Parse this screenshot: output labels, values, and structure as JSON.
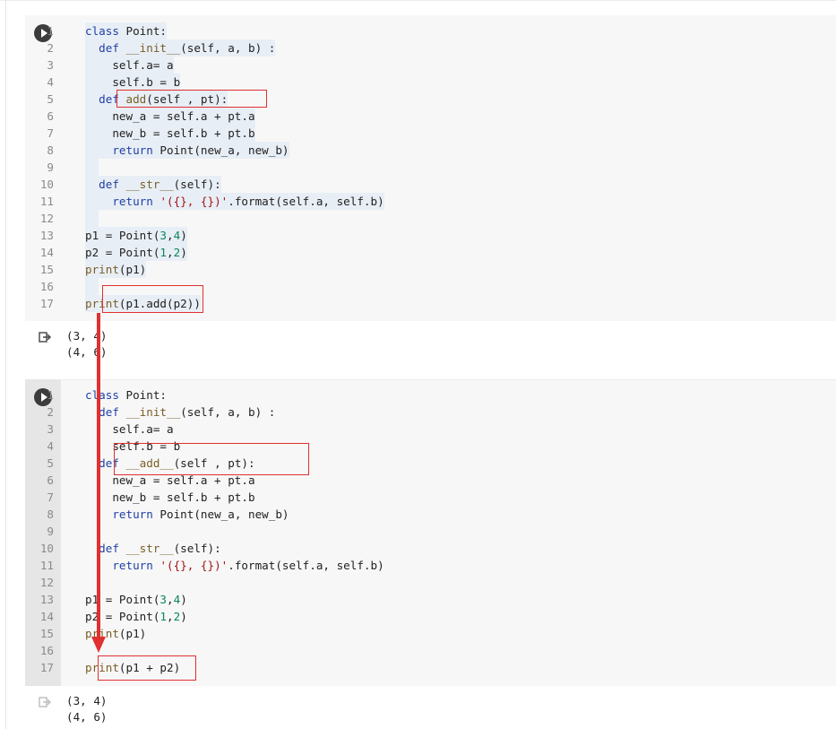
{
  "cells": [
    {
      "id": "cell-1",
      "run_icon": "play-circle-icon",
      "lines": [
        {
          "n": "1",
          "tokens": [
            [
              "kw",
              "class"
            ],
            [
              "",
              " Point:"
            ]
          ]
        },
        {
          "n": "2",
          "tokens": [
            [
              "",
              "  "
            ],
            [
              "kw",
              "def"
            ],
            [
              "",
              " "
            ],
            [
              "fn",
              "__init__"
            ],
            [
              "",
              "(self, a, b) :"
            ]
          ]
        },
        {
          "n": "3",
          "tokens": [
            [
              "",
              "    self.a= a"
            ]
          ]
        },
        {
          "n": "4",
          "tokens": [
            [
              "",
              "    self.b = b"
            ]
          ]
        },
        {
          "n": "5",
          "tokens": [
            [
              "",
              "  "
            ],
            [
              "kw",
              "def"
            ],
            [
              "",
              " "
            ],
            [
              "fn",
              "add"
            ],
            [
              "",
              "(self , pt):"
            ]
          ]
        },
        {
          "n": "6",
          "tokens": [
            [
              "",
              "    new_a = self.a + pt.a"
            ]
          ]
        },
        {
          "n": "7",
          "tokens": [
            [
              "",
              "    new_b = self.b + pt.b"
            ]
          ]
        },
        {
          "n": "8",
          "tokens": [
            [
              "",
              "    "
            ],
            [
              "kw",
              "return"
            ],
            [
              "",
              " Point(new_a, new_b)"
            ]
          ]
        },
        {
          "n": "9",
          "tokens": [
            [
              "",
              "  "
            ]
          ]
        },
        {
          "n": "10",
          "tokens": [
            [
              "",
              "  "
            ],
            [
              "kw",
              "def"
            ],
            [
              "",
              " "
            ],
            [
              "fn",
              "__str__"
            ],
            [
              "",
              "(self):"
            ]
          ]
        },
        {
          "n": "11",
          "tokens": [
            [
              "",
              "    "
            ],
            [
              "kw",
              "return"
            ],
            [
              "",
              " "
            ],
            [
              "st",
              "'({}, {})'"
            ],
            [
              "",
              ".format(self.a, self.b)"
            ]
          ]
        },
        {
          "n": "12",
          "tokens": [
            [
              "",
              "  "
            ]
          ]
        },
        {
          "n": "13",
          "tokens": [
            [
              "",
              "p1 = Point("
            ],
            [
              "nm",
              "3"
            ],
            [
              "",
              ","
            ],
            [
              "nm",
              "4"
            ],
            [
              "",
              ")"
            ]
          ]
        },
        {
          "n": "14",
          "tokens": [
            [
              "",
              "p2 = Point("
            ],
            [
              "nm",
              "1"
            ],
            [
              "",
              ","
            ],
            [
              "nm",
              "2"
            ],
            [
              "",
              ")"
            ]
          ]
        },
        {
          "n": "15",
          "tokens": [
            [
              "fn",
              "print"
            ],
            [
              "",
              "(p1)"
            ]
          ]
        },
        {
          "n": "16",
          "tokens": [
            [
              "",
              "  "
            ]
          ]
        },
        {
          "n": "17",
          "tokens": [
            [
              "fn",
              "print"
            ],
            [
              "",
              "(p1.add(p2))"
            ]
          ]
        }
      ],
      "output": [
        "(3, 4)",
        "(4, 6)"
      ]
    },
    {
      "id": "cell-2",
      "run_icon": "play-circle-icon",
      "lines": [
        {
          "n": "1",
          "tokens": [
            [
              "kw",
              "class"
            ],
            [
              "",
              " Point:"
            ]
          ]
        },
        {
          "n": "2",
          "tokens": [
            [
              "",
              "  "
            ],
            [
              "kw",
              "def"
            ],
            [
              "",
              " "
            ],
            [
              "fn",
              "__init__"
            ],
            [
              "",
              "(self, a, b) :"
            ]
          ]
        },
        {
          "n": "3",
          "tokens": [
            [
              "",
              "    self.a= a"
            ]
          ]
        },
        {
          "n": "4",
          "tokens": [
            [
              "",
              "    self.b = b"
            ]
          ]
        },
        {
          "n": "5",
          "tokens": [
            [
              "",
              "  "
            ],
            [
              "kw",
              "def"
            ],
            [
              "",
              " "
            ],
            [
              "fn",
              "__add__"
            ],
            [
              "",
              "(self , pt):"
            ]
          ]
        },
        {
          "n": "6",
          "tokens": [
            [
              "",
              "    new_a = self.a + pt.a"
            ]
          ]
        },
        {
          "n": "7",
          "tokens": [
            [
              "",
              "    new_b = self.b + pt.b"
            ]
          ]
        },
        {
          "n": "8",
          "tokens": [
            [
              "",
              "    "
            ],
            [
              "kw",
              "return"
            ],
            [
              "",
              " Point(new_a, new_b)"
            ]
          ]
        },
        {
          "n": "9",
          "tokens": [
            [
              "",
              ""
            ]
          ]
        },
        {
          "n": "10",
          "tokens": [
            [
              "",
              "  "
            ],
            [
              "kw",
              "def"
            ],
            [
              "",
              " "
            ],
            [
              "fn",
              "__str__"
            ],
            [
              "",
              "(self):"
            ]
          ]
        },
        {
          "n": "11",
          "tokens": [
            [
              "",
              "    "
            ],
            [
              "kw",
              "return"
            ],
            [
              "",
              " "
            ],
            [
              "st",
              "'({}, {})'"
            ],
            [
              "",
              ".format(self.a, self.b)"
            ]
          ]
        },
        {
          "n": "12",
          "tokens": [
            [
              "",
              ""
            ]
          ]
        },
        {
          "n": "13",
          "tokens": [
            [
              "",
              "p1 = Point("
            ],
            [
              "nm",
              "3"
            ],
            [
              "",
              ","
            ],
            [
              "nm",
              "4"
            ],
            [
              "",
              ")"
            ]
          ]
        },
        {
          "n": "14",
          "tokens": [
            [
              "",
              "p2 = Point("
            ],
            [
              "nm",
              "1"
            ],
            [
              "",
              ","
            ],
            [
              "nm",
              "2"
            ],
            [
              "",
              ")"
            ]
          ]
        },
        {
          "n": "15",
          "tokens": [
            [
              "fn",
              "print"
            ],
            [
              "",
              "(p1)"
            ]
          ]
        },
        {
          "n": "16",
          "tokens": [
            [
              "",
              ""
            ]
          ]
        },
        {
          "n": "17",
          "tokens": [
            [
              "fn",
              "print"
            ],
            [
              "",
              "(p1 + p2)"
            ]
          ]
        }
      ],
      "output": [
        "(3, 4)",
        "(4, 6)"
      ]
    }
  ],
  "colors": {
    "annotation": "#e03030",
    "keyword": "#1f3fa6",
    "function": "#795e26",
    "string": "#a31515",
    "number": "#098658"
  },
  "icons": {
    "output_icon": "output-arrow-icon"
  }
}
